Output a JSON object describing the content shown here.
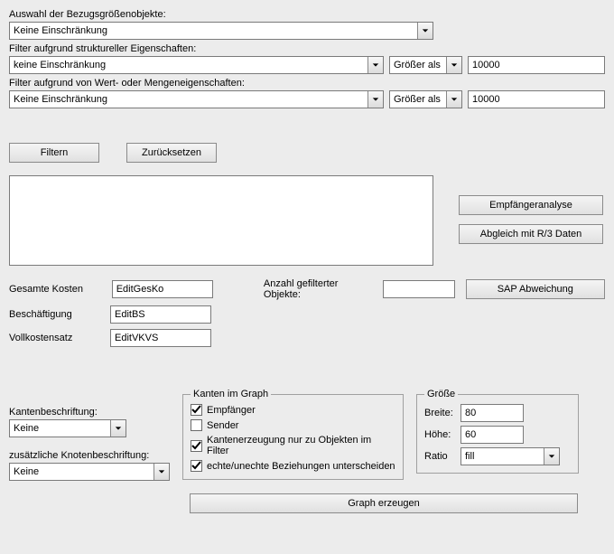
{
  "labels": {
    "auswahl": "Auswahl der Bezugsgrößenobjekte:",
    "filter_strukturell": "Filter aufgrund struktureller Eigenschaften:",
    "filter_wert": "Filter aufgrund von Wert- oder Mengeneigenschaften:",
    "gesamte_kosten": "Gesamte Kosten",
    "beschaeftigung": "Beschäftigung",
    "vollkostensatz": "Vollkostensatz",
    "anzahl_gefilterter": "Anzahl gefilterter Objekte:",
    "kantenbeschriftung": "Kantenbeschriftung:",
    "zusaetzliche_knoten": "zusätzliche Knotenbeschriftung:",
    "kanten_im_graph": "Kanten im Graph",
    "groesse": "Größe",
    "breite": "Breite:",
    "hoehe": "Höhe:",
    "ratio": "Ratio"
  },
  "selects": {
    "auswahl": "Keine Einschränkung",
    "filter_strukturell": "keine Einschränkung",
    "filter_wert": "Keine Einschränkung",
    "comp1": "Größer als",
    "comp2": "Größer als",
    "kantenbeschriftung": "Keine",
    "knotenbeschriftung": "Keine",
    "ratio": "fill"
  },
  "inputs": {
    "val1": "10000",
    "val2": "10000",
    "gesamte_kosten": "EditGesKo",
    "beschaeftigung": "EditBS",
    "vollkostensatz": "EditVKVS",
    "anzahl": "",
    "breite": "80",
    "hoehe": "60"
  },
  "buttons": {
    "filtern": "Filtern",
    "zuruecksetzen": "Zurücksetzen",
    "empfaengeranalyse": "Empfängeranalyse",
    "abgleich": "Abgleich mit R/3 Daten",
    "sap_abweichung": "SAP Abweichung",
    "graph_erzeugen": "Graph erzeugen"
  },
  "checkboxes": {
    "empfaenger": {
      "label": "Empfänger",
      "checked": true
    },
    "sender": {
      "label": "Sender",
      "checked": false
    },
    "kantenerzeugung": {
      "label": "Kantenerzeugung nur zu Objekten im Filter",
      "checked": true
    },
    "echte_unechte": {
      "label": "echte/unechte Beziehungen unterscheiden",
      "checked": true
    }
  }
}
